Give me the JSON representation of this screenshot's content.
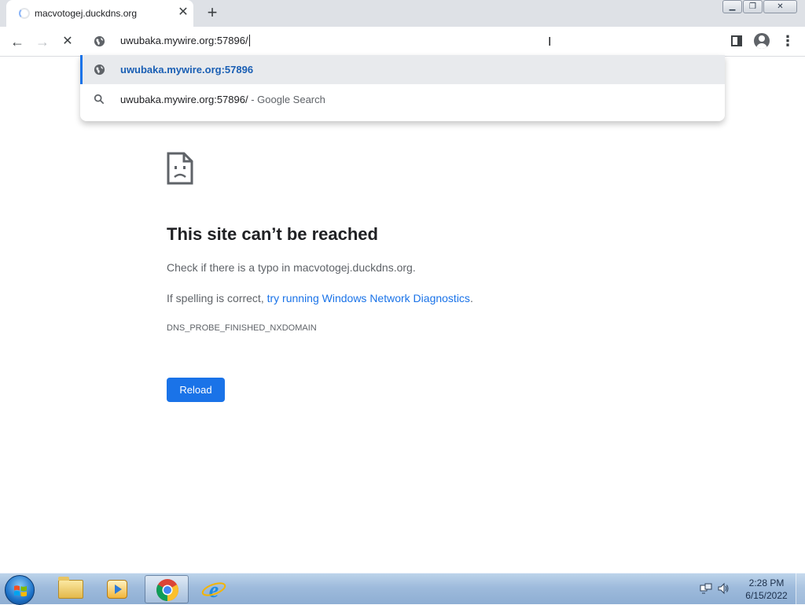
{
  "browser": {
    "tab": {
      "title": "macvotogej.duckdns.org",
      "close_glyph": "✕",
      "icon": "loading-spinner-icon"
    },
    "new_tab_glyph": "+",
    "window_controls": {
      "minimize": "▁",
      "restore": "❐",
      "close": "✕"
    },
    "nav": {
      "back": "←",
      "forward": "→",
      "stop": "✕"
    },
    "omnibox": {
      "value": "uwubaka.mywire.org:57896/",
      "icon": "globe-icon"
    },
    "suggestions": [
      {
        "text": "uwubaka.mywire.org:57896",
        "suffix": "",
        "icon": "globe-icon"
      },
      {
        "text": "uwubaka.mywire.org:57896/",
        "suffix": " - Google Search",
        "icon": "search-icon"
      }
    ],
    "menu_glyph": "⋮"
  },
  "error_page": {
    "icon": "sad-page-icon",
    "title": "This site can’t be reached",
    "line1": "Check if there is a typo in macvotogej.duckdns.org.",
    "line2_prefix": "If spelling is correct, ",
    "line2_link": "try running Windows Network Diagnostics",
    "line2_suffix": ".",
    "error_code": "DNS_PROBE_FINISHED_NXDOMAIN",
    "reload_label": "Reload"
  },
  "taskbar": {
    "items": [
      "windows-explorer-icon",
      "media-player-icon",
      "chrome-icon",
      "internet-explorer-icon"
    ],
    "clock": {
      "time": "2:28 PM",
      "date": "6/15/2022"
    }
  },
  "colors": {
    "accent": "#1a73e8",
    "tab_strip": "#dee1e6",
    "taskbar": "#9ebbdc"
  }
}
